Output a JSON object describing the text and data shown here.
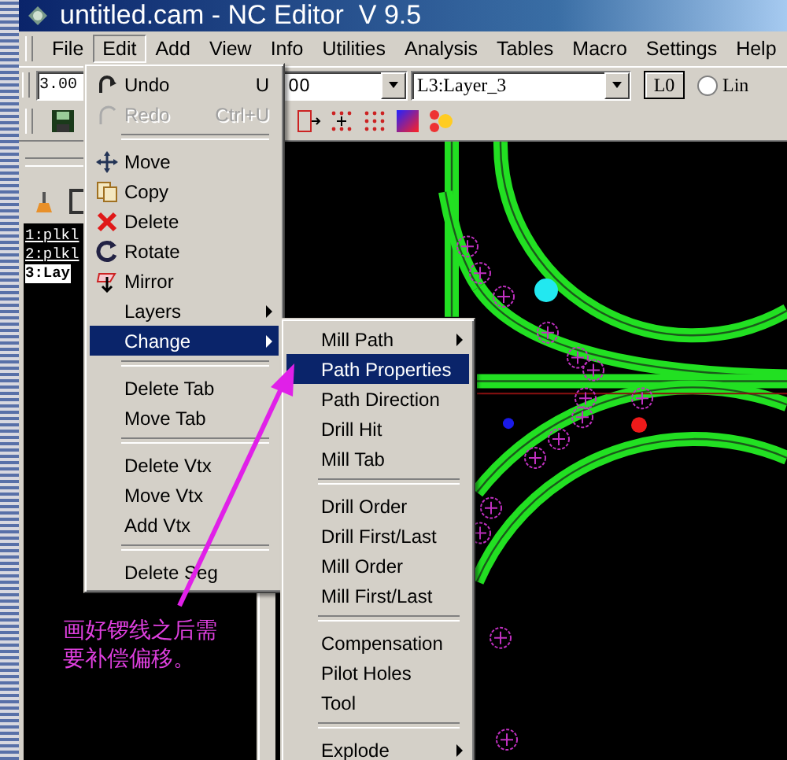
{
  "window": {
    "title": "untitled.cam - NC Editor  V 9.5"
  },
  "menu_bar": [
    {
      "label": "File",
      "selected": false
    },
    {
      "label": "Edit",
      "selected": true
    },
    {
      "label": "Add",
      "selected": false
    },
    {
      "label": "View",
      "selected": false
    },
    {
      "label": "Info",
      "selected": false
    },
    {
      "label": "Utilities",
      "selected": false
    },
    {
      "label": "Analysis",
      "selected": false
    },
    {
      "label": "Tables",
      "selected": false
    },
    {
      "label": "Macro",
      "selected": false
    },
    {
      "label": "Settings",
      "selected": false
    },
    {
      "label": "Help",
      "selected": false
    }
  ],
  "toolbar": {
    "value_field": "3.00",
    "combo_field": "00",
    "layer_combo": "L3:Layer_3",
    "layer_button": "L0",
    "radio": {
      "label": "Lin",
      "selected": false
    }
  },
  "layer_list": [
    {
      "label": "1:plkl",
      "selected": false
    },
    {
      "label": "2:plkl",
      "selected": false
    },
    {
      "label": "3:Lay",
      "selected": true
    }
  ],
  "edit_menu": [
    {
      "kind": "item",
      "label": "Undo",
      "shortcut": "U",
      "disabled": false,
      "selected": false,
      "submenu": false
    },
    {
      "kind": "item",
      "label": "Redo",
      "shortcut": "Ctrl+U",
      "disabled": true,
      "selected": false,
      "submenu": false
    },
    {
      "kind": "separator"
    },
    {
      "kind": "item",
      "label": "Move",
      "disabled": false,
      "selected": false,
      "submenu": false
    },
    {
      "kind": "item",
      "label": "Copy",
      "disabled": false,
      "selected": false,
      "submenu": false
    },
    {
      "kind": "item",
      "label": "Delete",
      "disabled": false,
      "selected": false,
      "submenu": false
    },
    {
      "kind": "item",
      "label": "Rotate",
      "disabled": false,
      "selected": false,
      "submenu": false
    },
    {
      "kind": "item",
      "label": "Mirror",
      "disabled": false,
      "selected": false,
      "submenu": false
    },
    {
      "kind": "item",
      "label": "Layers",
      "disabled": false,
      "selected": false,
      "submenu": true
    },
    {
      "kind": "item",
      "label": "Change",
      "disabled": false,
      "selected": true,
      "submenu": true
    },
    {
      "kind": "separator"
    },
    {
      "kind": "item",
      "label": "Delete Tab",
      "disabled": false,
      "selected": false,
      "submenu": false
    },
    {
      "kind": "item",
      "label": "Move Tab",
      "disabled": false,
      "selected": false,
      "submenu": false
    },
    {
      "kind": "separator"
    },
    {
      "kind": "item",
      "label": "Delete Vtx",
      "disabled": false,
      "selected": false,
      "submenu": false
    },
    {
      "kind": "item",
      "label": "Move Vtx",
      "disabled": false,
      "selected": false,
      "submenu": false
    },
    {
      "kind": "item",
      "label": "Add Vtx",
      "disabled": false,
      "selected": false,
      "submenu": false
    },
    {
      "kind": "separator"
    },
    {
      "kind": "item",
      "label": "Delete Seg",
      "disabled": false,
      "selected": false,
      "submenu": false
    }
  ],
  "change_submenu": [
    {
      "kind": "item",
      "label": "Mill Path",
      "disabled": false,
      "selected": false,
      "submenu": true
    },
    {
      "kind": "item",
      "label": "Path Properties",
      "disabled": false,
      "selected": true,
      "submenu": false
    },
    {
      "kind": "item",
      "label": "Path Direction",
      "disabled": false,
      "selected": false,
      "submenu": false
    },
    {
      "kind": "item",
      "label": "Drill Hit",
      "disabled": false,
      "selected": false,
      "submenu": false
    },
    {
      "kind": "item",
      "label": "Mill Tab",
      "disabled": false,
      "selected": false,
      "submenu": false
    },
    {
      "kind": "separator"
    },
    {
      "kind": "item",
      "label": "Drill Order",
      "disabled": false,
      "selected": false,
      "submenu": false
    },
    {
      "kind": "item",
      "label": "Drill First/Last",
      "disabled": false,
      "selected": false,
      "submenu": false
    },
    {
      "kind": "item",
      "label": "Mill Order",
      "disabled": false,
      "selected": false,
      "submenu": false
    },
    {
      "kind": "item",
      "label": "Mill First/Last",
      "disabled": false,
      "selected": false,
      "submenu": false
    },
    {
      "kind": "separator"
    },
    {
      "kind": "item",
      "label": "Compensation",
      "disabled": false,
      "selected": false,
      "submenu": false
    },
    {
      "kind": "item",
      "label": "Pilot Holes",
      "disabled": false,
      "selected": false,
      "submenu": false
    },
    {
      "kind": "item",
      "label": "Tool",
      "disabled": false,
      "selected": false,
      "submenu": false
    },
    {
      "kind": "separator"
    },
    {
      "kind": "item",
      "label": "Explode",
      "disabled": false,
      "selected": false,
      "submenu": true
    }
  ],
  "annotation": "画好锣线之后需要补偿偏移。"
}
